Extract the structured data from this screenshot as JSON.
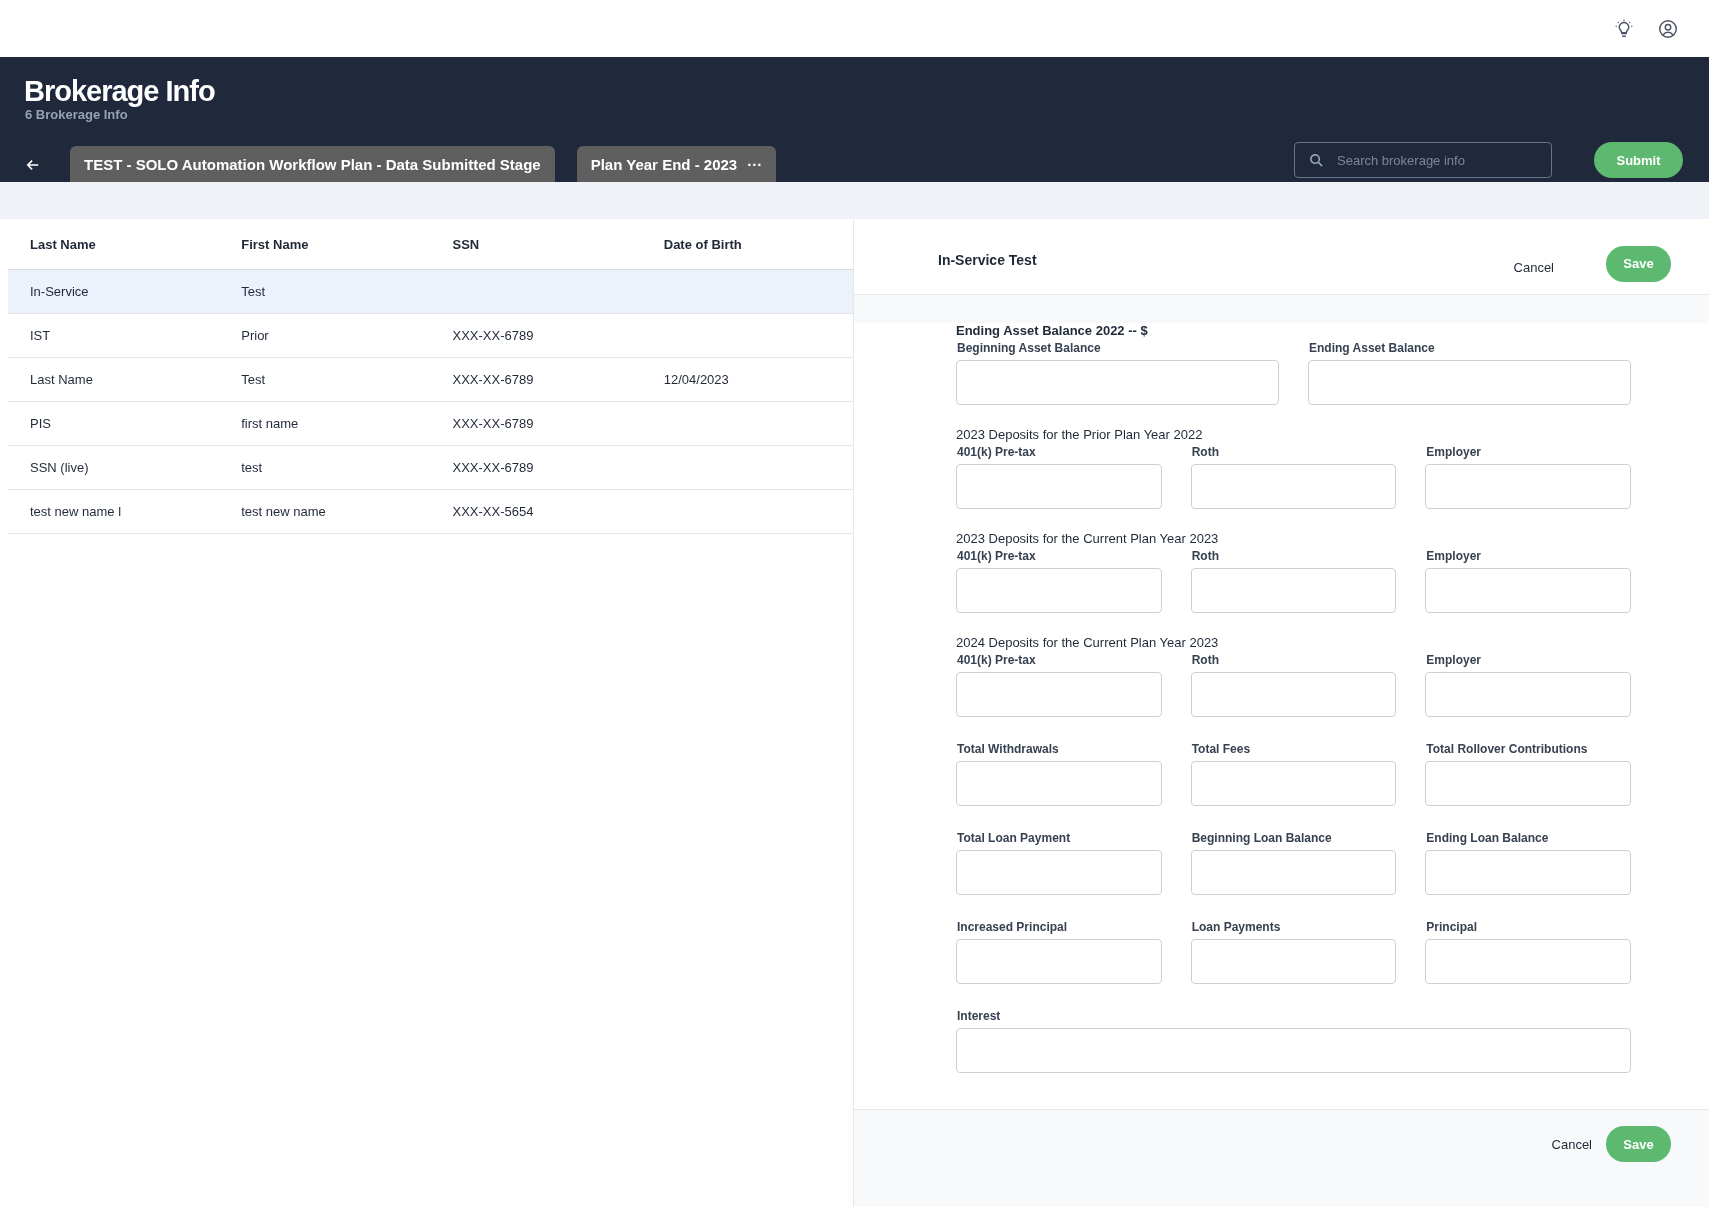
{
  "header": {
    "title": "Brokerage Info",
    "subtitle": "6 Brokerage Info",
    "tabs": [
      {
        "label": "TEST - SOLO Automation Workflow Plan - Data Submitted Stage"
      },
      {
        "label": "Plan Year End - 2023",
        "menu": "···"
      }
    ],
    "search": {
      "placeholder": "Search brokerage info"
    },
    "submit": "Submit"
  },
  "table": {
    "columns": [
      "Last Name",
      "First Name",
      "SSN",
      "Date of Birth"
    ],
    "rows": [
      {
        "cells": [
          "In-Service",
          "Test",
          "",
          ""
        ],
        "selected": true
      },
      {
        "cells": [
          "IST",
          "Prior",
          "XXX-XX-6789",
          ""
        ],
        "selected": false
      },
      {
        "cells": [
          "Last Name",
          "Test",
          "XXX-XX-6789",
          "12/04/2023"
        ],
        "selected": false
      },
      {
        "cells": [
          "PIS",
          "first name",
          "XXX-XX-6789",
          ""
        ],
        "selected": false
      },
      {
        "cells": [
          "SSN (live)",
          "test",
          "XXX-XX-6789",
          ""
        ],
        "selected": false
      },
      {
        "cells": [
          "test new name l",
          "test new name",
          "XXX-XX-5654",
          ""
        ],
        "selected": false
      }
    ]
  },
  "panel": {
    "title": "In-Service Test",
    "cancel": "Cancel",
    "save": "Save",
    "sections": [
      {
        "heading": "Ending Asset Balance 2022 -- $",
        "kind": "bold",
        "fields": [
          "Beginning Asset Balance",
          "Ending Asset Balance"
        ]
      },
      {
        "heading": "2023 Deposits for the Prior Plan Year 2022",
        "kind": "plain",
        "fields": [
          "401(k) Pre-tax",
          "Roth",
          "Employer"
        ]
      },
      {
        "heading": "2023 Deposits for the Current Plan Year 2023",
        "kind": "plain",
        "fields": [
          "401(k) Pre-tax",
          "Roth",
          "Employer"
        ]
      },
      {
        "heading": "2024 Deposits for the Current Plan Year 2023",
        "kind": "plain",
        "fields": [
          "401(k) Pre-tax",
          "Roth",
          "Employer"
        ]
      },
      {
        "kind": "none",
        "fields": [
          "Total Withdrawals",
          "Total Fees",
          "Total Rollover Contributions"
        ]
      },
      {
        "kind": "none",
        "fields": [
          "Total Loan Payment",
          "Beginning Loan Balance",
          "Ending Loan Balance"
        ]
      },
      {
        "kind": "none",
        "fields": [
          "Increased Principal",
          "Loan Payments",
          "Principal"
        ]
      },
      {
        "kind": "none",
        "fields": [
          "Interest"
        ]
      }
    ],
    "footer": {
      "cancel": "Cancel",
      "save": "Save"
    }
  }
}
